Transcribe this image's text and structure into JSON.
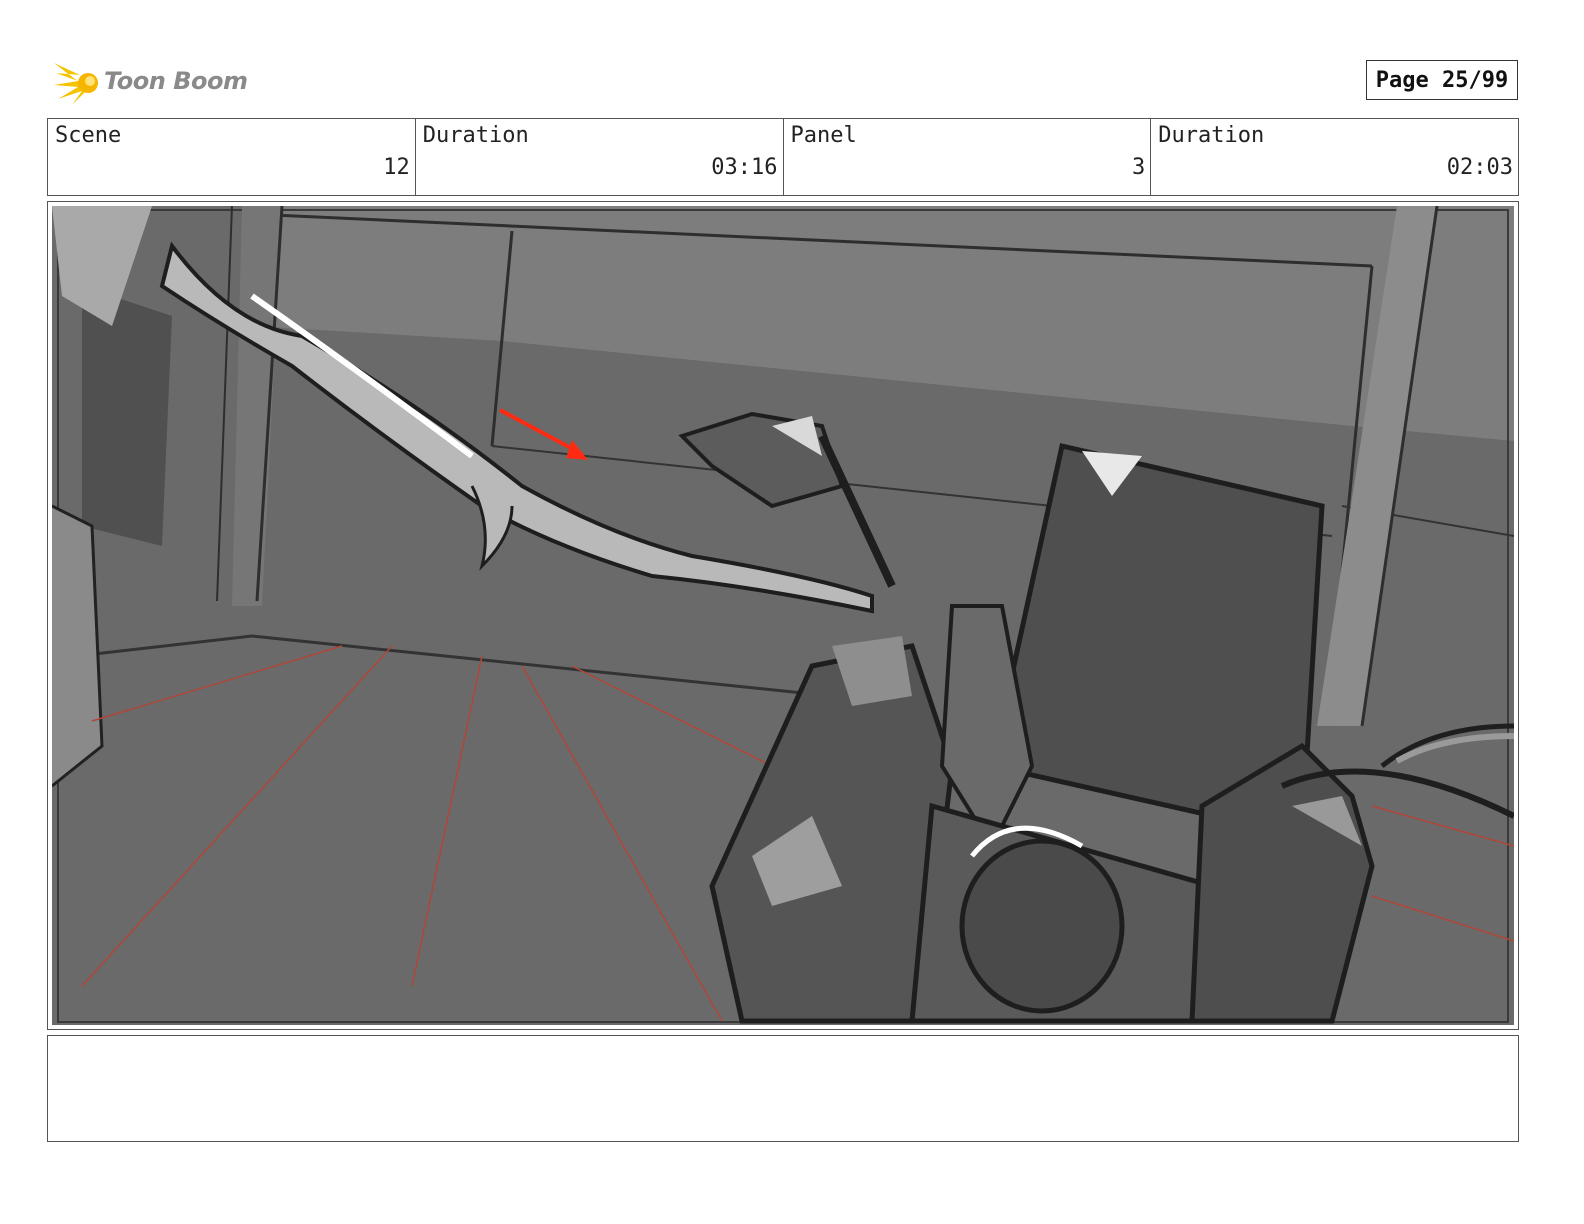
{
  "header": {
    "brand": "Toon Boom",
    "page_label": "Page 25/99"
  },
  "info": {
    "scene_label": "Scene",
    "scene_value": "12",
    "scene_duration_label": "Duration",
    "scene_duration_value": "03:16",
    "panel_label": "Panel",
    "panel_value": "3",
    "panel_duration_label": "Duration",
    "panel_duration_value": "02:03"
  },
  "panel": {
    "image_icon": "storyboard-sketch",
    "annotation_arrow_color": "#ff2a12",
    "perspective_line_color": "#b0463a"
  },
  "notes": {
    "text": ""
  }
}
